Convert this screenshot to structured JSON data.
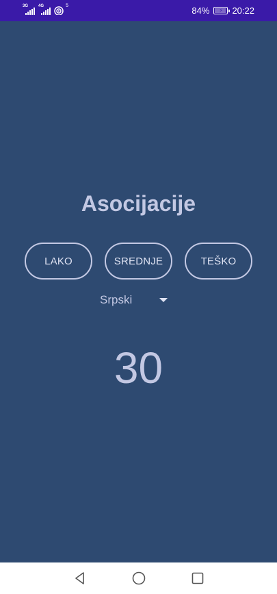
{
  "status_bar": {
    "signal1_tag": "3G",
    "signal2_tag": "4G",
    "wifi_badge": "5",
    "battery_percent": "84%",
    "battery_level": 0.84,
    "time": "20:22",
    "icons": [
      "cell-signal-icon",
      "cell-signal-icon",
      "wifi-icon",
      "battery-charging-icon"
    ]
  },
  "app": {
    "title": "Asocijacije",
    "difficulty_buttons": [
      "LAKO",
      "SREDNJE",
      "TEŠKO"
    ],
    "language_select": {
      "selected": "Srpski"
    },
    "timer": "30"
  },
  "nav_bar": {
    "icons": [
      "back-icon",
      "home-icon",
      "recents-icon"
    ]
  },
  "colors": {
    "status_bar_bg": "#3a1aa8",
    "app_bg": "#2e4a71",
    "text": "#c3c8e3",
    "nav_bg": "#ffffff"
  }
}
